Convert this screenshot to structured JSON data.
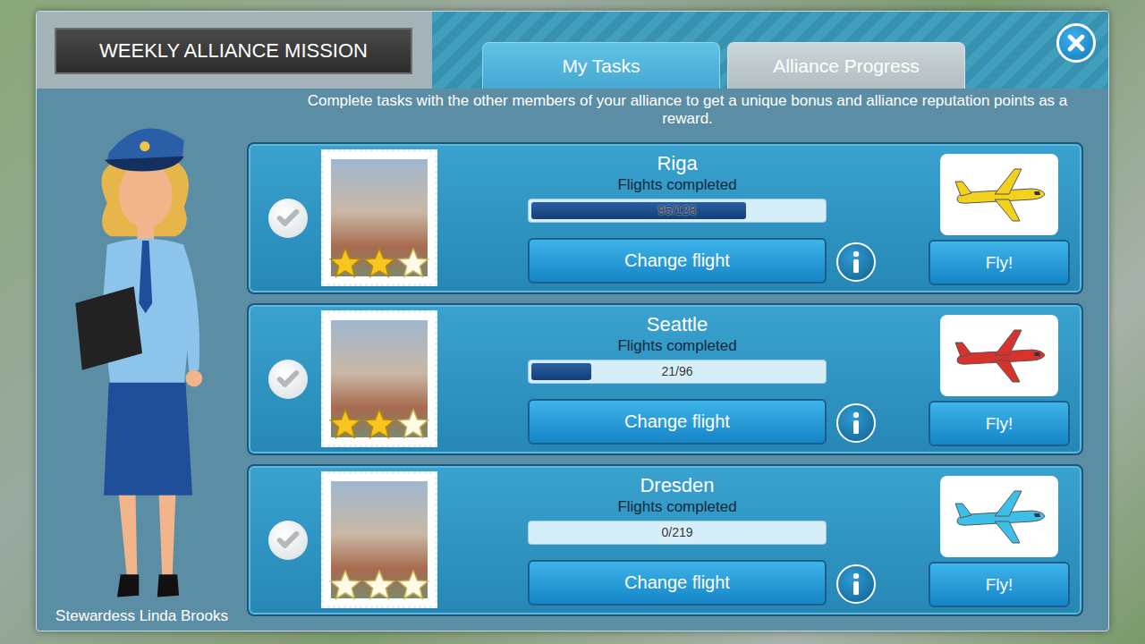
{
  "header": {
    "title": "WEEKLY ALLIANCE MISSION"
  },
  "tabs": [
    {
      "label": "My Tasks",
      "selected": true
    },
    {
      "label": "Alliance Progress",
      "selected": false
    }
  ],
  "description": "Complete tasks with the other members of your alliance to get a unique bonus and alliance reputation points as a reward.",
  "character": {
    "name": "Stewardess Linda Brooks"
  },
  "tasks": [
    {
      "city": "Riga",
      "caption": "Flights completed",
      "progress": "95/128",
      "level": 0.742,
      "stars": 2,
      "completed": false,
      "change_button": "Change flight",
      "fly_button": "Fly!",
      "color": "#f2d21c"
    },
    {
      "city": "Seattle",
      "caption": "Flights completed",
      "progress": "21/96",
      "level": 0.219,
      "stars": 2,
      "completed": false,
      "change_button": "Change flight",
      "fly_button": "Fly!",
      "color": "#d8322c"
    },
    {
      "city": "Dresden",
      "caption": "Flights completed",
      "progress": "0/219",
      "level": 0,
      "stars": 0,
      "completed": false,
      "change_button": "Change flight",
      "fly_button": "Fly!",
      "color": "#3cc0ea"
    }
  ]
}
